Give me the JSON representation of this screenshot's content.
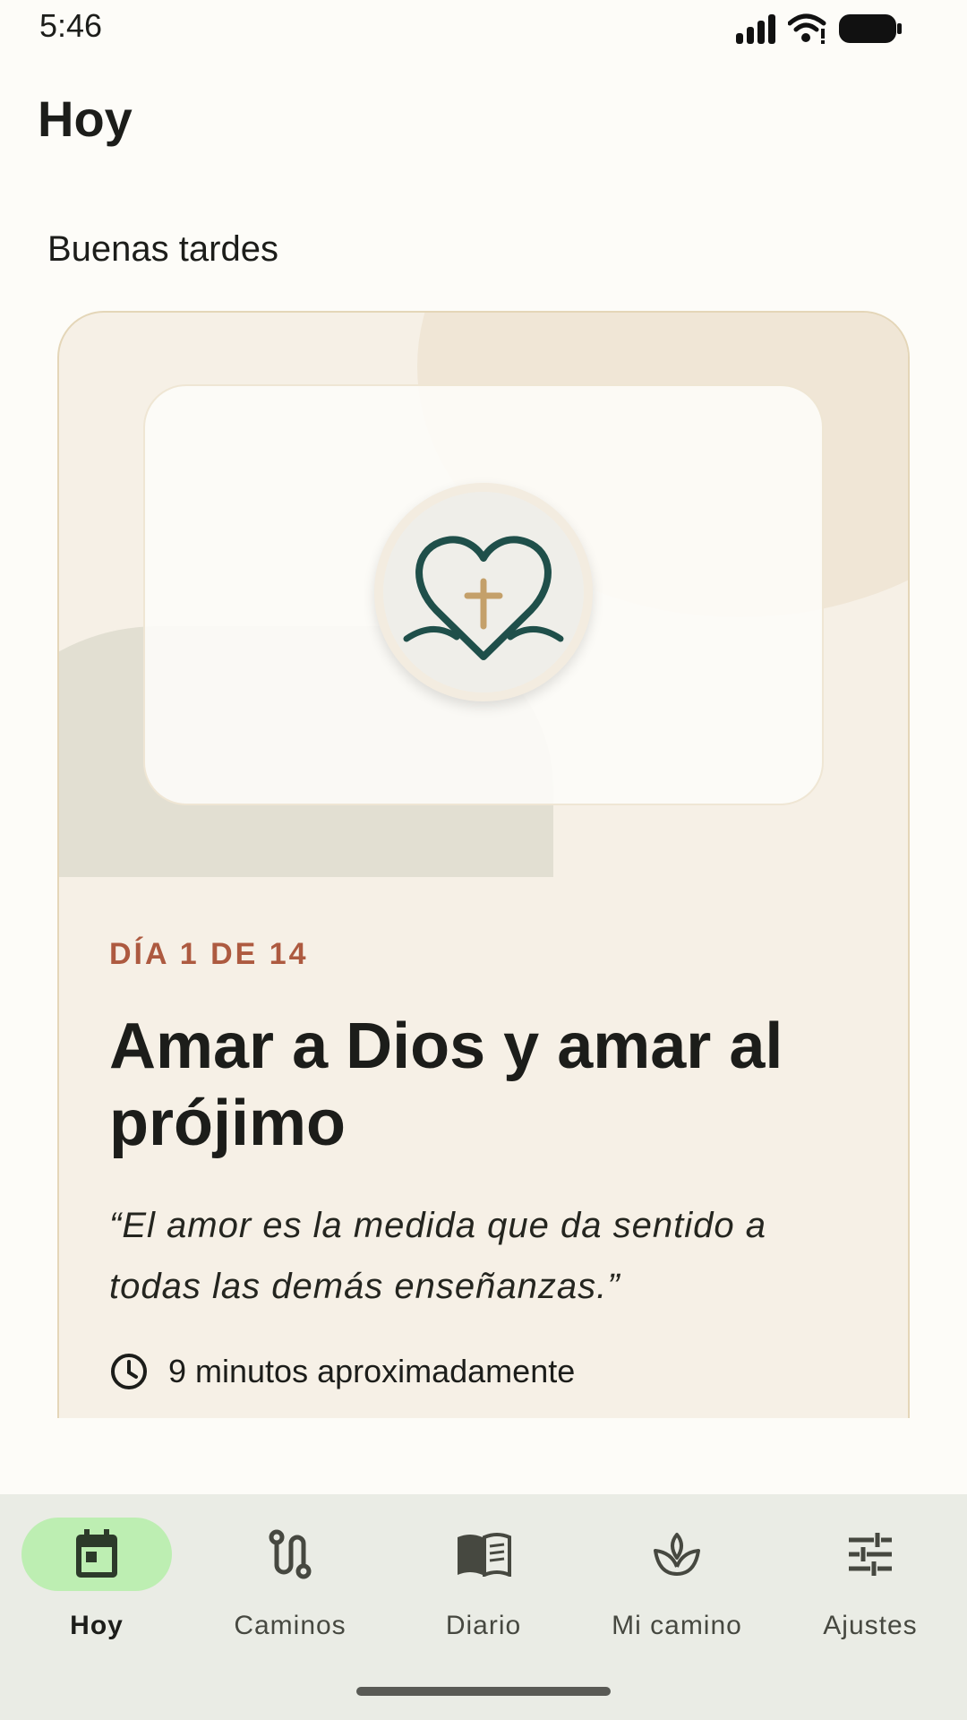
{
  "status_bar": {
    "time": "5:46"
  },
  "header": {
    "title": "Hoy"
  },
  "greeting": "Buenas tardes",
  "card": {
    "day_label": "DÍA 1 DE 14",
    "title": "Amar a Dios y amar al prójimo",
    "quote": "“El amor es la medida que da sentido a todas las demás enseñanzas.”",
    "duration": "9 minutos aproximadamente"
  },
  "nav": {
    "items": [
      {
        "label": "Hoy",
        "icon": "calendar-icon",
        "active": true
      },
      {
        "label": "Caminos",
        "icon": "route-icon",
        "active": false
      },
      {
        "label": "Diario",
        "icon": "book-icon",
        "active": false
      },
      {
        "label": "Mi camino",
        "icon": "sprout-icon",
        "active": false
      },
      {
        "label": "Ajustes",
        "icon": "tune-icon",
        "active": false
      }
    ]
  },
  "colors": {
    "accent": "#ad5a40",
    "nav_active": "#bdeeb2",
    "emblem": "#1f4f4a",
    "cross": "#c4a06a"
  }
}
